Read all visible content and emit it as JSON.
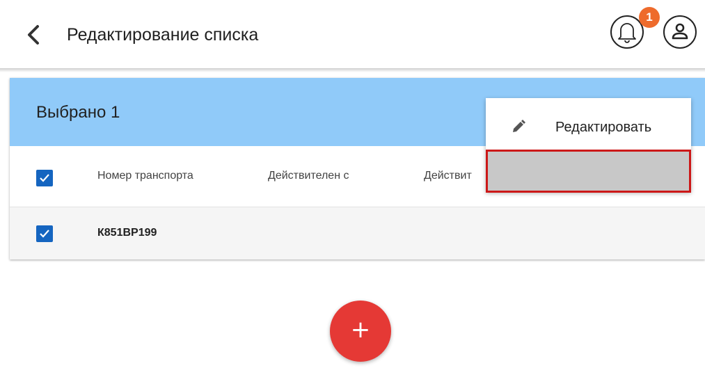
{
  "header": {
    "title": "Редактирование списка",
    "notification_count": "1"
  },
  "selection": {
    "label": "Выбрано 1"
  },
  "table": {
    "columns": [
      "Номер транспорта",
      "Действителен с",
      "Действит"
    ],
    "rows": [
      {
        "vehicle_number": "К851ВР199",
        "checked": true
      }
    ],
    "header_checked": true
  },
  "context_menu": {
    "items": [
      {
        "label": "Редактировать",
        "icon": "pencil-icon"
      },
      {
        "label": ""
      }
    ]
  },
  "fab": {
    "label": "+"
  },
  "colors": {
    "accent_blue": "#1565c0",
    "selection_bar": "#90caf9",
    "badge": "#ee6b2c",
    "fab": "#e53935",
    "highlight_border": "#cc1818"
  }
}
